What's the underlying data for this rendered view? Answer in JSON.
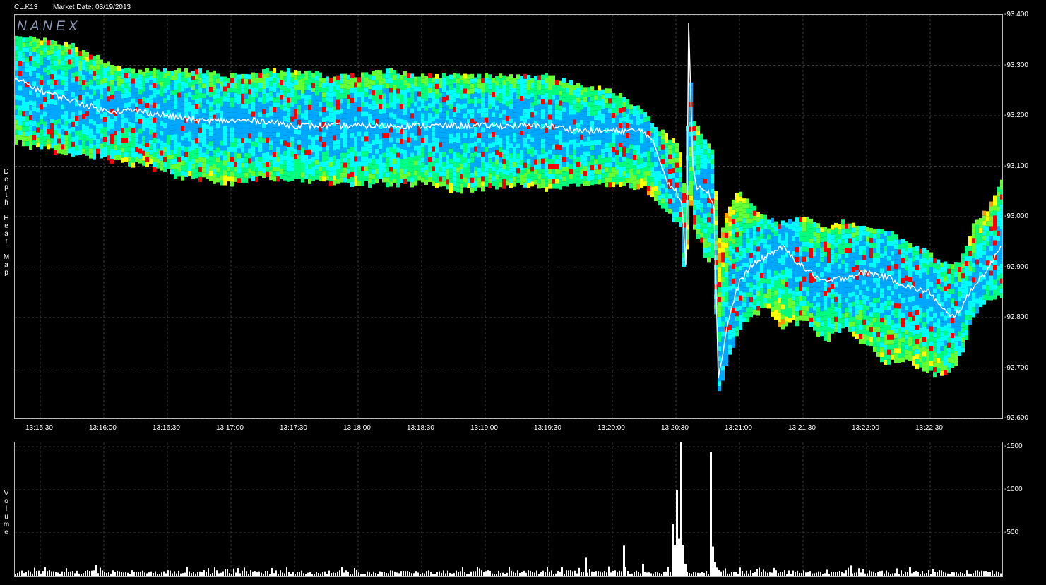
{
  "header": {
    "symbol": "CL.K13",
    "market_date": "Market Date: 03/19/2013"
  },
  "watermark": "NANEX",
  "heatmap_ylabel": "Depth Heat Map",
  "volume_ylabel": "Volume",
  "colors": {
    "background": "#000000",
    "grid": "#3a3a3a",
    "axis": "#b8b8b8",
    "price_line": "#ffffff",
    "volume_bar": "#ffffff",
    "heat_scale": [
      "#00a8ff",
      "#00ffff",
      "#00ff7f",
      "#66ff33",
      "#ffff00",
      "#ff9900",
      "#ff0000"
    ]
  },
  "chart_data": [
    {
      "type": "heatmap",
      "title": "",
      "xlabel": "",
      "ylabel": "Depth Heat Map",
      "x_ticks": [
        "13:15:30",
        "13:16:00",
        "13:16:30",
        "13:17:00",
        "13:17:30",
        "13:18:00",
        "13:18:30",
        "13:19:00",
        "13:19:30",
        "13:20:00",
        "13:20:30",
        "13:21:00",
        "13:21:30",
        "13:22:00",
        "13:22:30"
      ],
      "y_ticks": [
        "93.400",
        "93.300",
        "93.200",
        "93.100",
        "93.000",
        "92.900",
        "92.800",
        "92.700",
        "92.600"
      ],
      "ylim": [
        92.6,
        93.4
      ],
      "xlim_seconds_from_13_15_00": [
        18,
        484
      ],
      "grid": true,
      "price_series": {
        "name": "",
        "t": [
          20,
          30,
          45,
          60,
          75,
          90,
          105,
          120,
          135,
          150,
          165,
          180,
          195,
          210,
          225,
          240,
          255,
          270,
          285,
          300,
          315,
          320,
          326,
          330,
          333,
          335,
          336,
          338,
          340,
          342,
          345,
          348,
          350,
          355,
          360,
          365,
          372,
          380,
          390,
          400,
          410,
          420,
          430,
          440,
          450,
          455,
          460,
          465,
          470,
          478,
          484
        ],
        "price": [
          93.27,
          93.25,
          93.23,
          93.21,
          93.21,
          93.2,
          93.19,
          93.19,
          93.19,
          93.18,
          93.18,
          93.18,
          93.18,
          93.18,
          93.18,
          93.18,
          93.18,
          93.18,
          93.17,
          93.17,
          93.17,
          93.14,
          93.07,
          93.05,
          93.02,
          92.88,
          93.39,
          93.1,
          93.06,
          93.06,
          93.05,
          93.02,
          92.68,
          92.8,
          92.87,
          92.9,
          92.92,
          92.94,
          92.9,
          92.87,
          92.88,
          92.89,
          92.88,
          92.86,
          92.85,
          92.82,
          92.8,
          92.82,
          92.86,
          92.9,
          92.95
        ]
      },
      "depth_band": {
        "t": [
          20,
          45,
          60,
          75,
          90,
          105,
          120,
          135,
          150,
          165,
          180,
          195,
          210,
          225,
          240,
          255,
          270,
          285,
          300,
          315,
          320,
          326,
          330,
          333,
          335,
          336,
          338,
          340,
          342,
          345,
          348,
          350,
          355,
          360,
          372,
          380,
          390,
          400,
          410,
          420,
          430,
          440,
          450,
          455,
          460,
          465,
          470,
          478,
          484
        ],
        "upper": [
          93.36,
          93.34,
          93.31,
          93.29,
          93.29,
          93.29,
          93.28,
          93.29,
          93.29,
          93.28,
          93.28,
          93.29,
          93.28,
          93.28,
          93.28,
          93.28,
          93.28,
          93.26,
          93.25,
          93.21,
          93.18,
          93.16,
          93.15,
          93.12,
          93.0,
          93.36,
          93.2,
          93.18,
          93.16,
          93.15,
          93.12,
          92.95,
          93.02,
          93.05,
          93.0,
          92.99,
          93.0,
          92.98,
          92.99,
          92.98,
          92.97,
          92.95,
          92.93,
          92.91,
          92.9,
          92.92,
          92.98,
          93.02,
          93.08
        ],
        "lower": [
          93.15,
          93.13,
          93.12,
          93.11,
          93.09,
          93.08,
          93.07,
          93.08,
          93.08,
          93.07,
          93.07,
          93.07,
          93.07,
          93.06,
          93.06,
          93.07,
          93.06,
          93.07,
          93.07,
          93.06,
          93.04,
          93.01,
          92.99,
          92.98,
          92.8,
          93.09,
          92.98,
          92.96,
          92.95,
          92.92,
          92.92,
          92.65,
          92.72,
          92.78,
          92.83,
          92.78,
          92.8,
          92.76,
          92.78,
          92.75,
          92.71,
          92.72,
          92.69,
          92.69,
          92.7,
          92.73,
          92.8,
          92.84,
          92.85
        ]
      }
    },
    {
      "type": "bar",
      "title": "",
      "xlabel": "",
      "ylabel": "Volume",
      "y_ticks": [
        "1500",
        "1000",
        "500"
      ],
      "ylim": [
        0,
        1550
      ],
      "grid": true,
      "spikes": [
        {
          "t": 56,
          "value": 130
        },
        {
          "t": 287,
          "value": 210
        },
        {
          "t": 298,
          "value": 110
        },
        {
          "t": 305,
          "value": 350
        },
        {
          "t": 314,
          "value": 140
        },
        {
          "t": 328,
          "value": 600
        },
        {
          "t": 329,
          "value": 360
        },
        {
          "t": 330,
          "value": 1000
        },
        {
          "t": 331,
          "value": 430
        },
        {
          "t": 332,
          "value": 1550
        },
        {
          "t": 333,
          "value": 360
        },
        {
          "t": 334,
          "value": 140
        },
        {
          "t": 346,
          "value": 1440
        },
        {
          "t": 347,
          "value": 340
        },
        {
          "t": 348,
          "value": 160
        },
        {
          "t": 412,
          "value": 120
        },
        {
          "t": 440,
          "value": 100
        }
      ]
    }
  ]
}
